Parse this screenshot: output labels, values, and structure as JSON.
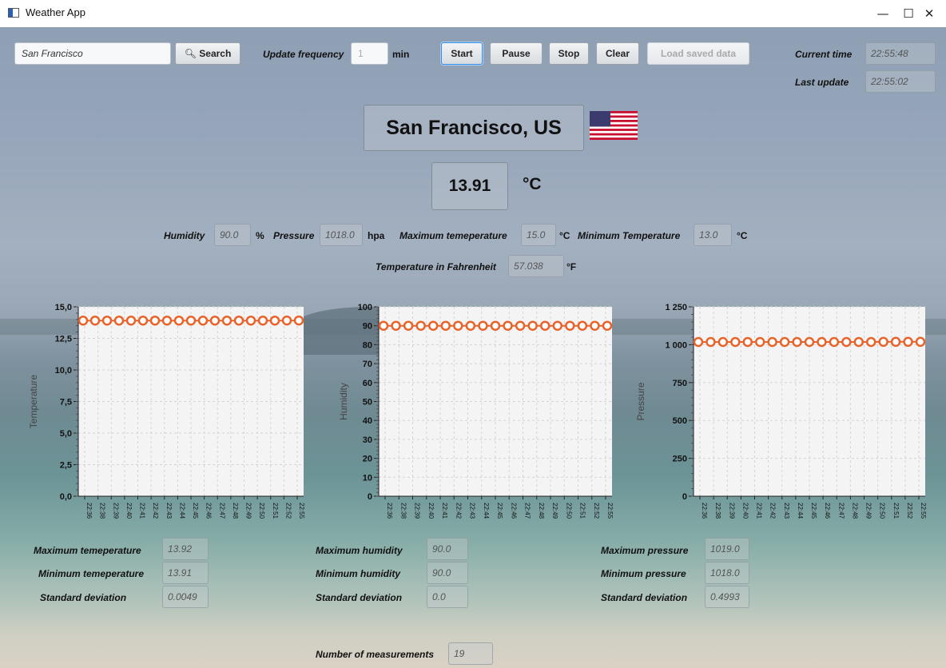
{
  "window": {
    "title": "Weather App",
    "minimize": "—",
    "maximize": "☐",
    "close": "✕"
  },
  "toolbar": {
    "search_value": "San Francisco",
    "search_label": "Search",
    "update_frequency_label": "Update frequency",
    "update_frequency_value": "1",
    "update_frequency_unit": "min",
    "start": "Start",
    "pause": "Pause",
    "stop": "Stop",
    "clear": "Clear",
    "load_saved": "Load saved data",
    "current_time_label": "Current time",
    "current_time": "22:55:48",
    "last_update_label": "Last update",
    "last_update": "22:55:02"
  },
  "location": {
    "city": "San Francisco, US",
    "flag_icon": "us-flag-icon"
  },
  "current": {
    "temperature": "13.91",
    "temperature_unit": "°C",
    "humidity_label": "Humidity",
    "humidity": "90.0",
    "humidity_unit": "%",
    "pressure_label": "Pressure",
    "pressure": "1018.0",
    "pressure_unit": "hpa",
    "max_temp_label": "Maximum temeperature",
    "max_temp": "15.0",
    "max_temp_unit": "°C",
    "min_temp_label": "Minimum Temperature",
    "min_temp": "13.0",
    "min_temp_unit": "°C",
    "fahrenheit_label": "Temperature in Fahrenheit",
    "fahrenheit": "57.038",
    "fahrenheit_unit": "°F"
  },
  "stats": {
    "temperature": {
      "max_label": "Maximum temeperature",
      "max": "13.92",
      "min_label": "Minimum temeperature",
      "min": "13.91",
      "sd_label": "Standard deviation",
      "sd": "0.0049"
    },
    "humidity": {
      "max_label": "Maximum humidity",
      "max": "90.0",
      "min_label": "Minimum humidity",
      "min": "90.0",
      "sd_label": "Standard deviation",
      "sd": "0.0"
    },
    "pressure": {
      "max_label": "Maximum pressure",
      "max": "1019.0",
      "min_label": "Minimum pressure",
      "min": "1018.0",
      "sd_label": "Standard deviation",
      "sd": "0.4993"
    },
    "count_label": "Number of measurements",
    "count": "19"
  },
  "colors": {
    "series": "#e8632b",
    "plot_bg": "#f4f4f4",
    "grid": "#d4d4d4"
  },
  "chart_data": [
    {
      "type": "line",
      "ylabel": "Temperature",
      "ylim": [
        0,
        15
      ],
      "y_ticks": [
        "0,0",
        "2,5",
        "5,0",
        "7,5",
        "10,0",
        "12,5",
        "15,0"
      ],
      "y_tick_values": [
        0,
        2.5,
        5,
        7.5,
        10,
        12.5,
        15
      ],
      "x": [
        "22:36",
        "22:38",
        "22:39",
        "22:40",
        "22:41",
        "22:42",
        "22:43",
        "22:44",
        "22:45",
        "22:46",
        "22:47",
        "22:48",
        "22:49",
        "22:50",
        "22:51",
        "22:52",
        "22:55"
      ],
      "values": [
        13.91,
        13.91,
        13.91,
        13.91,
        13.91,
        13.91,
        13.91,
        13.91,
        13.91,
        13.91,
        13.91,
        13.91,
        13.91,
        13.91,
        13.91,
        13.91,
        13.91,
        13.92,
        13.92
      ]
    },
    {
      "type": "line",
      "ylabel": "Humidity",
      "ylim": [
        0,
        100
      ],
      "y_ticks": [
        "0",
        "10",
        "20",
        "30",
        "40",
        "50",
        "60",
        "70",
        "80",
        "90",
        "100"
      ],
      "y_tick_values": [
        0,
        10,
        20,
        30,
        40,
        50,
        60,
        70,
        80,
        90,
        100
      ],
      "x": [
        "22:36",
        "22:38",
        "22:39",
        "22:40",
        "22:41",
        "22:42",
        "22:43",
        "22:44",
        "22:45",
        "22:46",
        "22:47",
        "22:48",
        "22:49",
        "22:50",
        "22:51",
        "22:52",
        "22:55"
      ],
      "values": [
        90,
        90,
        90,
        90,
        90,
        90,
        90,
        90,
        90,
        90,
        90,
        90,
        90,
        90,
        90,
        90,
        90,
        90,
        90
      ]
    },
    {
      "type": "line",
      "ylabel": "Pressure",
      "ylim": [
        0,
        1250
      ],
      "y_ticks": [
        "0",
        "250",
        "500",
        "750",
        "1 000",
        "1 250"
      ],
      "y_tick_values": [
        0,
        250,
        500,
        750,
        1000,
        1250
      ],
      "x": [
        "22:36",
        "22:38",
        "22:39",
        "22:40",
        "22:41",
        "22:42",
        "22:43",
        "22:44",
        "22:45",
        "22:46",
        "22:47",
        "22:48",
        "22:49",
        "22:50",
        "22:51",
        "22:52",
        "22:55"
      ],
      "values": [
        1018,
        1018,
        1018,
        1018,
        1018,
        1018,
        1018,
        1018,
        1018,
        1018,
        1018,
        1018,
        1018,
        1018,
        1018,
        1019,
        1019,
        1019,
        1019
      ]
    }
  ]
}
